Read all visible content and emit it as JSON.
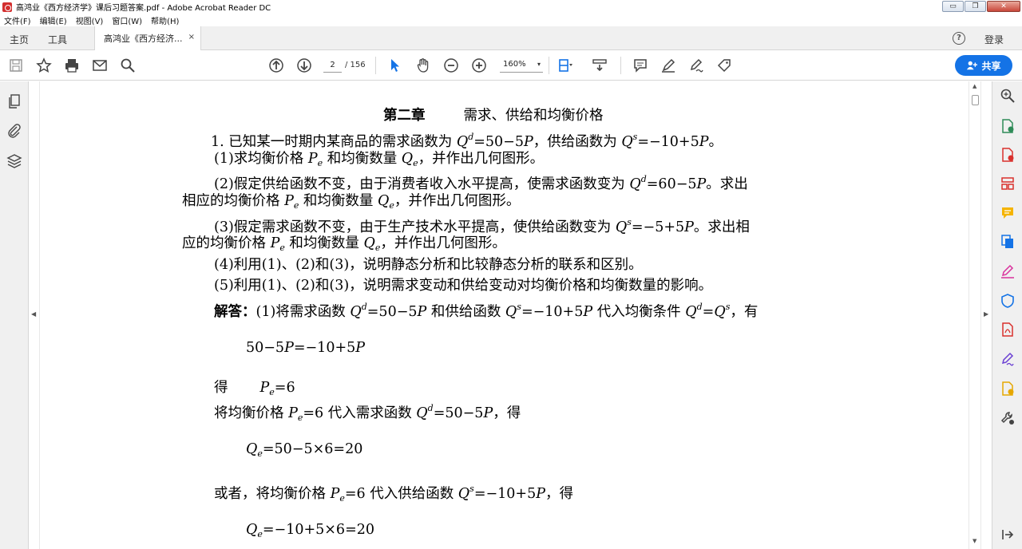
{
  "window": {
    "title": "高鸿业《西方经济学》课后习题答案.pdf - Adobe Acrobat Reader DC",
    "buttons": [
      "▭",
      "❐",
      "✕"
    ]
  },
  "menu": [
    "文件(F)",
    "编辑(E)",
    "视图(V)",
    "窗口(W)",
    "帮助(H)"
  ],
  "tabs": {
    "home": "主页",
    "tools": "工具",
    "document": "高鸿业《西方经济...",
    "close": "×",
    "help": "?",
    "login": "登录"
  },
  "toolbar": {
    "page_current": "2",
    "page_total": "/ 156",
    "zoom": "160%",
    "zoom_caret": "▾",
    "share_label": "共享"
  },
  "document": {
    "chapter_title": "第二章",
    "chapter_subtitle": "需求、供给和均衡价格",
    "lines": [
      "1.  已知某一时期内某商品的需求函数为 Q^d=50−5P，供给函数为 Q^s=−10+5P。",
      "(1)求均衡价格 P_e 和均衡数量 Q_e，并作出几何图形。",
      "(2)假定供给函数不变，由于消费者收入水平提高，使需求函数变为 Q^d=60−5P。求出",
      "相应的均衡价格 P_e 和均衡数量 Q_e，并作出几何图形。",
      "(3)假定需求函数不变，由于生产技术水平提高，使供给函数变为 Q^s=−5+5P。求出相",
      "应的均衡价格 P_e 和均衡数量 Q_e，并作出几何图形。",
      "(4)利用(1)、(2)和(3)，说明静态分析和比较静态分析的联系和区别。",
      "(5)利用(1)、(2)和(3)，说明需求变动和供给变动对均衡价格和均衡数量的影响。",
      "解答：(1)将需求函数 Q^d=50−5P 和供给函数 Q^s=−10+5P 代入均衡条件 Q^d=Q^s，有",
      "50−5P=−10+5P",
      "得     P_e=6",
      "将均衡价格 P_e=6 代入需求函数 Q^d=50−5P，得",
      "Q_e=50−5×6=20",
      "或者，将均衡价格 P_e=6 代入供给函数 Q^s=−10+5P，得",
      "Q_e=−10+5×6=20"
    ]
  },
  "panes": {
    "left_collapse": "◀",
    "right_collapse": "▶",
    "scroll_up": "▲",
    "scroll_down": "▼"
  },
  "colors": {
    "accent": "#1473e6",
    "chrome": "#f0f0f0"
  }
}
